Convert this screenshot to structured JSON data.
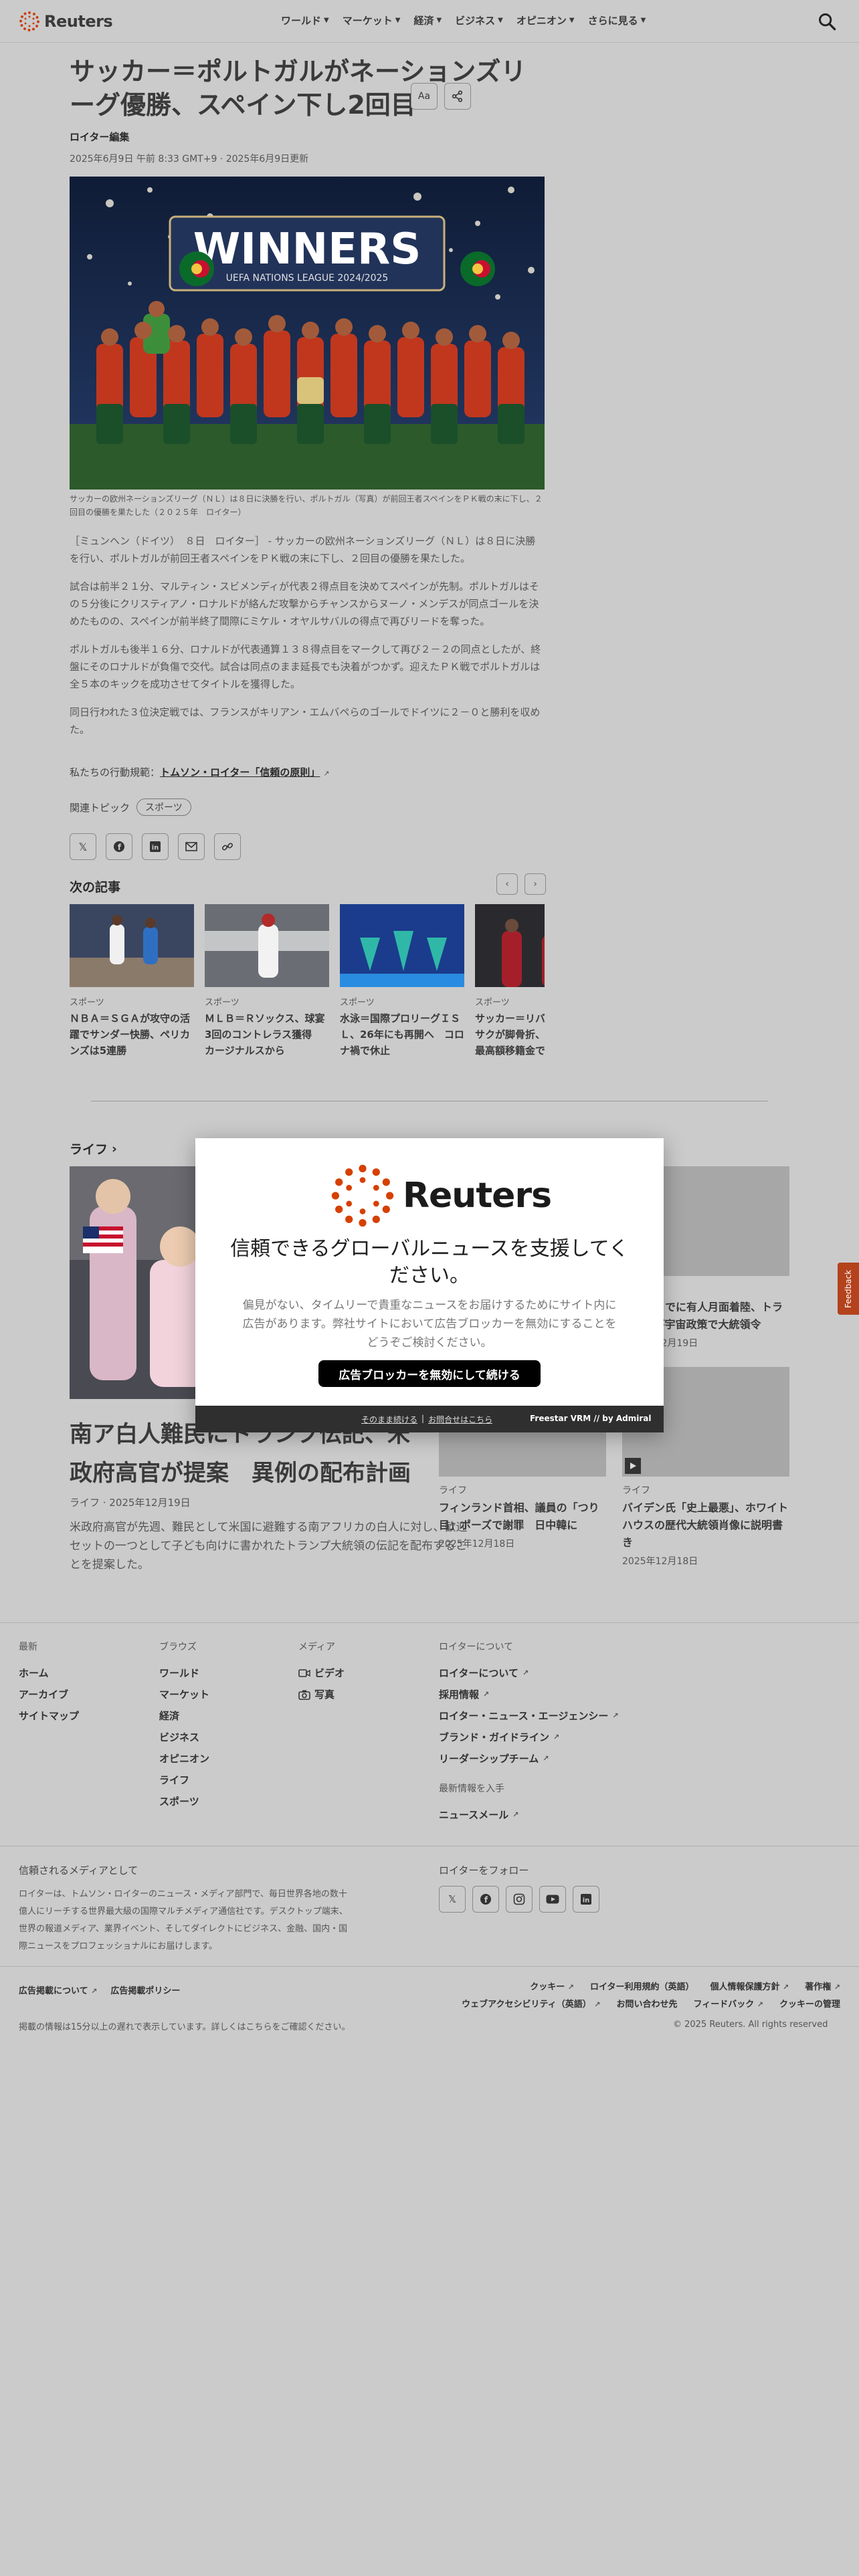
{
  "brand": {
    "name": "Reuters",
    "accent": "#d64000"
  },
  "nav": {
    "items": [
      {
        "label": "ワールド"
      },
      {
        "label": "マーケット"
      },
      {
        "label": "経済"
      },
      {
        "label": "ビジネス"
      },
      {
        "label": "オピニオン"
      },
      {
        "label": "さらに見る"
      }
    ]
  },
  "article": {
    "headline": "サッカー＝ポルトガルがネーションズリーグ優勝、スペイン下し2回目",
    "byline": "ロイター編集",
    "dateline": "2025年6月9日 午前 8:33 GMT+9 · 2025年6月9日更新",
    "font_tool": "Aa",
    "hero_banner": "WINNERS",
    "hero_sub": "UEFA NATIONS LEAGUE 2024/2025",
    "caption": "サッカーの欧州ネーションズリーグ（ＮＬ）は８日に決勝を行い、ポルトガル（写真）が前回王者スペインをＰＫ戦の末に下し、２回目の優勝を果たした（２０２５年　ロイター）",
    "paragraphs": [
      "［ミュンヘン（ドイツ）　８日　ロイター］ - サッカーの欧州ネーションズリーグ（ＮＬ）は８日に決勝を行い、ポルトガルが前回王者スペインをＰＫ戦の末に下し、２回目の優勝を果たした。",
      "試合は前半２１分、マルティン・スビメンディが代表２得点目を決めてスペインが先制。ポルトガルはその５分後にクリスティアノ・ロナルドが絡んだ攻撃からチャンスからヌーノ・メンデスが同点ゴールを決めたものの、スペインが前半終了間際にミケル・オヤルサバルの得点で再びリードを奪った。",
      "ポルトガルも後半１６分、ロナルドが代表通算１３８得点目をマークして再び２－２の同点としたが、終盤にそのロナルドが負傷で交代。試合は同点のまま延長でも決着がつかず。迎えたＰＫ戦でポルトガルは全５本のキックを成功させてタイトルを獲得した。",
      "同日行われた３位決定戦では、フランスがキリアン・エムバペらのゴールでドイツに２－０と勝利を収めた。"
    ],
    "conduct_prefix": "私たちの行動規範：",
    "conduct_link": "トムソン・ロイター「信頼の原則」",
    "topics_label": "関連トピック",
    "topic": "スポーツ"
  },
  "next": {
    "title": "次の記事",
    "cards": [
      {
        "kicker": "スポーツ",
        "title": "ＮＢＡ＝ＳＧＡが攻守の活躍でサンダー快勝、ペリカンズは5連勝"
      },
      {
        "kicker": "スポーツ",
        "title": "ＭＬＢ＝Ｒソックス、球宴3回のコントレラス獲得　カージナルスから"
      },
      {
        "kicker": "スポーツ",
        "title": "水泳＝国際プロリーグＩＳＬ、26年にも再開へ　コロナ禍で休止"
      },
      {
        "kicker": "スポーツ",
        "title": "サッカー＝リバプールのイサクが脚骨折、クラブ史上最高額移籍金で"
      }
    ]
  },
  "life": {
    "section": "ライフ",
    "main": {
      "title": "南ア白人難民にトランプ伝記、米政府高官が提案　異例の配布計画",
      "meta": "ライフ · 2025年12月19日",
      "desc": "米政府高官が先週、難民として米国に避難する南アフリカの白人に対し、歓迎セットの一つとして子ども向けに書かれたトランプ大統領の伝記を配布することを提案した。"
    },
    "side": [
      {
        "kicker": "ライフ",
        "title": "フィンランド首相、議員の「つり目」ポーズで謝罪　日中韓に",
        "date": "2025年12月18日"
      },
      {
        "kicker": "ライフ",
        "title": "バイデン氏「史上最悪」、ホワイトハウスの歴代大統領肖像に説明書き",
        "date": "2025年12月18日"
      },
      {
        "kicker": "ライフ",
        "title": "２８年までに有人月面着陸、トランプ氏が宇宙政策で大統領令",
        "date": "2025年12月19日"
      }
    ]
  },
  "modal": {
    "logo_text": "Reuters",
    "title": "信頼できるグローバルニュースを支援してください。",
    "desc": "偏見がない、タイムリーで貴重なニュースをお届けするためにサイト内に広告があります。弊社サイトにおいて広告ブロッカーを無効にすることをどうぞご検討ください。",
    "button": "広告ブロッカーを無効にして続ける",
    "link_continue": "そのまま続ける",
    "link_sep": "|",
    "link_help": "お問合せはこちら",
    "provider": "Freestar VRM // by Admiral"
  },
  "feedback": "Feedback",
  "footer": {
    "cols": [
      {
        "head": "最新",
        "items": [
          "ホーム",
          "アーカイブ",
          "サイトマップ"
        ]
      },
      {
        "head": "ブラウズ",
        "items": [
          "ワールド",
          "マーケット",
          "経済",
          "ビジネス",
          "オピニオン",
          "ライフ",
          "スポーツ"
        ]
      },
      {
        "head": "メディア",
        "items": [
          "ビデオ",
          "写真"
        ]
      },
      {
        "head": "ロイターについて",
        "items": [
          "ロイターについて",
          "採用情報",
          "ロイター・ニュース・エージェンシー",
          "ブランド・ガイドライン",
          "リーダーシップチーム"
        ]
      }
    ],
    "updates_head": "最新情報を入手",
    "updates_item": "ニュースメール",
    "trusted_head": "信頼されるメディアとして",
    "trusted_desc": "ロイターは、トムソン・ロイターのニュース・メディア部門で、毎日世界各地の数十億人にリーチする世界最大級の国際マルチメディア通信社です。デスクトップ端末、世界の報道メディア、業界イベント、そしてダイレクトにビジネス、金融、国内・国際ニュースをプロフェッショナルにお届けします。",
    "follow_head": "ロイターをフォロー",
    "legal_left": [
      "広告掲載について",
      "広告掲載ポリシー"
    ],
    "legal_right": [
      "クッキー",
      "ロイター利用規約（英語）",
      "個人情報保護方針",
      "著作権",
      "ウェブアクセシビリティ（英語）",
      "お問い合わせ先",
      "フィードバック",
      "クッキーの管理"
    ],
    "disclaimer": "掲載の情報は15分以上の遅れで表示しています。詳しくはこちらをご確認ください。",
    "copyright": "© 2025 Reuters. All rights reserved"
  }
}
